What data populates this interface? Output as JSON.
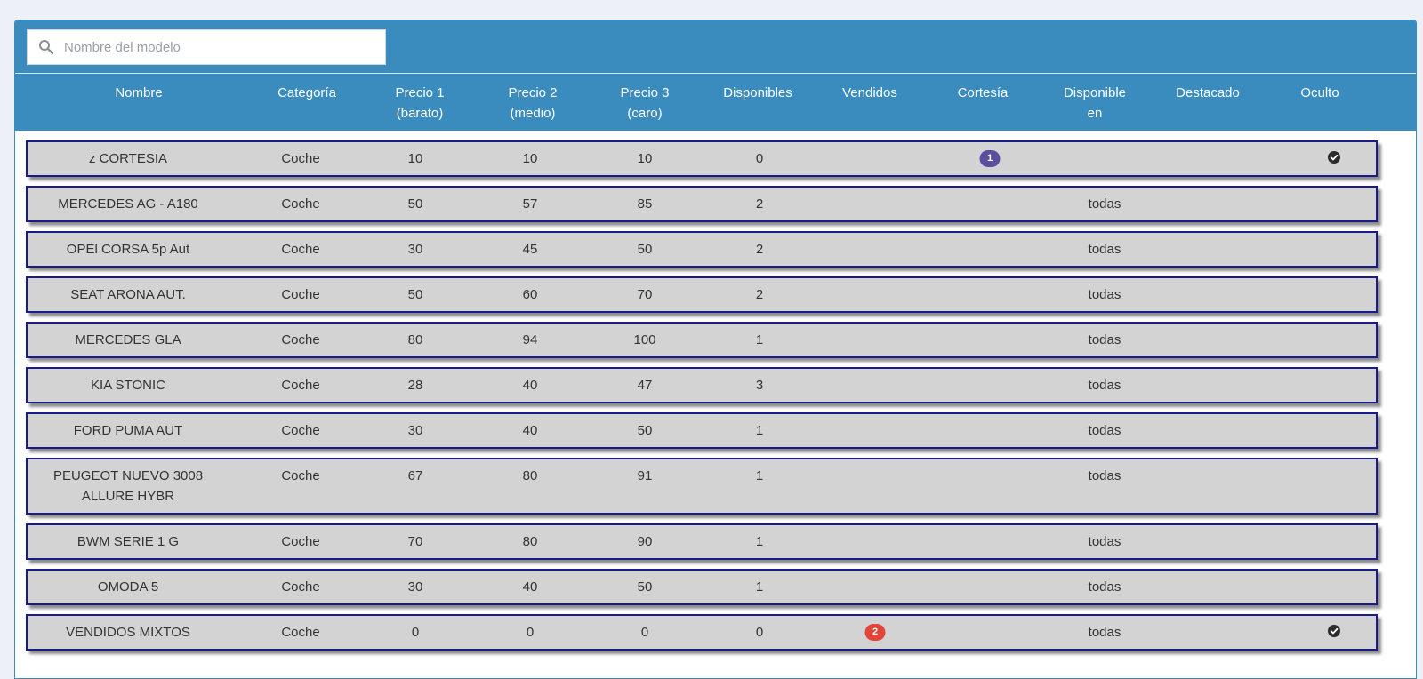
{
  "search": {
    "placeholder": "Nombre del modelo",
    "value": ""
  },
  "columns": {
    "nombre": "Nombre",
    "categoria": "Categoría",
    "precio1": [
      "Precio 1",
      "(barato)"
    ],
    "precio2": [
      "Precio 2",
      "(medio)"
    ],
    "precio3": [
      "Precio 3",
      "(caro)"
    ],
    "disponibles": "Disponibles",
    "vendidos": "Vendidos",
    "cortesia": "Cortesía",
    "disponible_en": [
      "Disponible",
      "en"
    ],
    "destacado": "Destacado",
    "oculto": "Oculto"
  },
  "rows": [
    {
      "nombre": "z CORTESIA",
      "categoria": "Coche",
      "precio1": "10",
      "precio2": "10",
      "precio3": "10",
      "disponibles": "0",
      "vendidos": "",
      "cortesia": "1",
      "disponible_en": "",
      "destacado": "",
      "oculto": true
    },
    {
      "nombre": "MERCEDES AG - A180",
      "categoria": "Coche",
      "precio1": "50",
      "precio2": "57",
      "precio3": "85",
      "disponibles": "2",
      "vendidos": "",
      "cortesia": "",
      "disponible_en": "todas",
      "destacado": "",
      "oculto": false
    },
    {
      "nombre": "OPEl CORSA 5p Aut",
      "categoria": "Coche",
      "precio1": "30",
      "precio2": "45",
      "precio3": "50",
      "disponibles": "2",
      "vendidos": "",
      "cortesia": "",
      "disponible_en": "todas",
      "destacado": "",
      "oculto": false
    },
    {
      "nombre": "SEAT ARONA AUT.",
      "categoria": "Coche",
      "precio1": "50",
      "precio2": "60",
      "precio3": "70",
      "disponibles": "2",
      "vendidos": "",
      "cortesia": "",
      "disponible_en": "todas",
      "destacado": "",
      "oculto": false
    },
    {
      "nombre": "MERCEDES GLA",
      "categoria": "Coche",
      "precio1": "80",
      "precio2": "94",
      "precio3": "100",
      "disponibles": "1",
      "vendidos": "",
      "cortesia": "",
      "disponible_en": "todas",
      "destacado": "",
      "oculto": false
    },
    {
      "nombre": "KIA STONIC",
      "categoria": "Coche",
      "precio1": "28",
      "precio2": "40",
      "precio3": "47",
      "disponibles": "3",
      "vendidos": "",
      "cortesia": "",
      "disponible_en": "todas",
      "destacado": "",
      "oculto": false
    },
    {
      "nombre": "FORD PUMA AUT",
      "categoria": "Coche",
      "precio1": "30",
      "precio2": "40",
      "precio3": "50",
      "disponibles": "1",
      "vendidos": "",
      "cortesia": "",
      "disponible_en": "todas",
      "destacado": "",
      "oculto": false
    },
    {
      "nombre": "PEUGEOT NUEVO 3008 ALLURE HYBR",
      "categoria": "Coche",
      "precio1": "67",
      "precio2": "80",
      "precio3": "91",
      "disponibles": "1",
      "vendidos": "",
      "cortesia": "",
      "disponible_en": "todas",
      "destacado": "",
      "oculto": false
    },
    {
      "nombre": "BWM SERIE 1 G",
      "categoria": "Coche",
      "precio1": "70",
      "precio2": "80",
      "precio3": "90",
      "disponibles": "1",
      "vendidos": "",
      "cortesia": "",
      "disponible_en": "todas",
      "destacado": "",
      "oculto": false
    },
    {
      "nombre": "OMODA 5",
      "categoria": "Coche",
      "precio1": "30",
      "precio2": "40",
      "precio3": "50",
      "disponibles": "1",
      "vendidos": "",
      "cortesia": "",
      "disponible_en": "todas",
      "destacado": "",
      "oculto": false
    },
    {
      "nombre": "VENDIDOS MIXTOS",
      "categoria": "Coche",
      "precio1": "0",
      "precio2": "0",
      "precio3": "0",
      "disponibles": "0",
      "vendidos": "2",
      "cortesia": "",
      "disponible_en": "todas",
      "destacado": "",
      "oculto": true
    }
  ],
  "colors": {
    "header_bg": "#3a8cbf",
    "row_bg": "#d4d3d4",
    "row_border": "#1a1a8c",
    "badge_cortesia": "#5b4e9c",
    "badge_vendidos": "#e0473a"
  },
  "icons": {
    "search": "search-icon",
    "oculto": "check-circle-icon"
  }
}
